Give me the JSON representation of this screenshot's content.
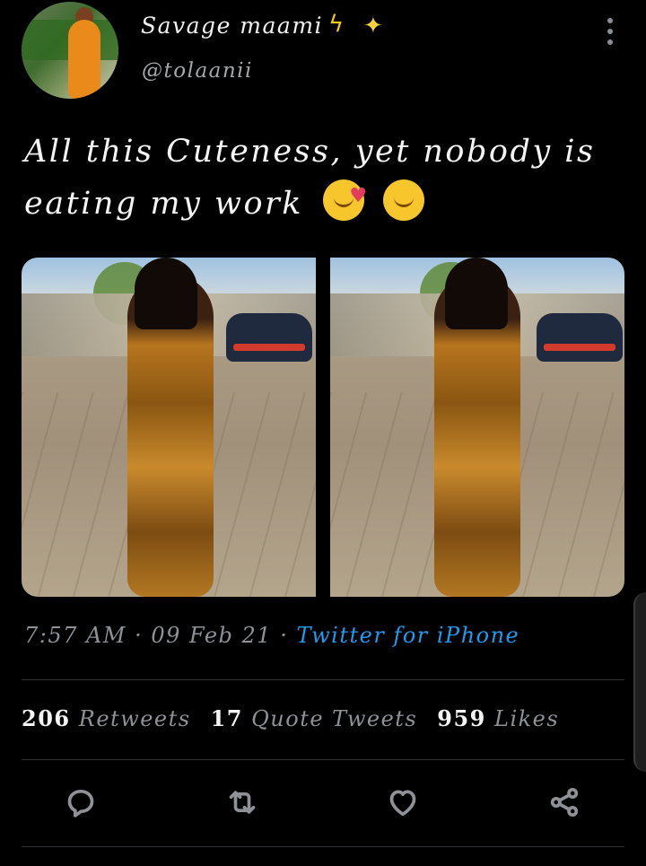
{
  "author": {
    "display_name": "Savage maami",
    "name_emojis": [
      "high-voltage",
      "sparkles"
    ],
    "handle": "@tolaanii"
  },
  "tweet": {
    "text": "All this Cuteness, yet nobody is eating my work",
    "text_emojis": [
      "smiling-face-with-hearts",
      "face-blowing-a-kiss"
    ]
  },
  "meta": {
    "time": "7:57 AM",
    "separator": " · ",
    "date": "09 Feb 21",
    "source": "Twitter  for  iPhone"
  },
  "stats": {
    "retweets_count": "206",
    "retweets_label": "Retweets",
    "quotes_count": "17",
    "quotes_label": "Quote Tweets",
    "likes_count": "959",
    "likes_label": "Likes"
  },
  "actions": [
    "reply-icon",
    "retweet-icon",
    "like-icon",
    "share-icon"
  ],
  "colors": {
    "background": "#000000",
    "primary_text": "#f4f4f4",
    "secondary_text": "#8e9297",
    "link": "#1d9bf0",
    "divider": "#2f3336"
  }
}
